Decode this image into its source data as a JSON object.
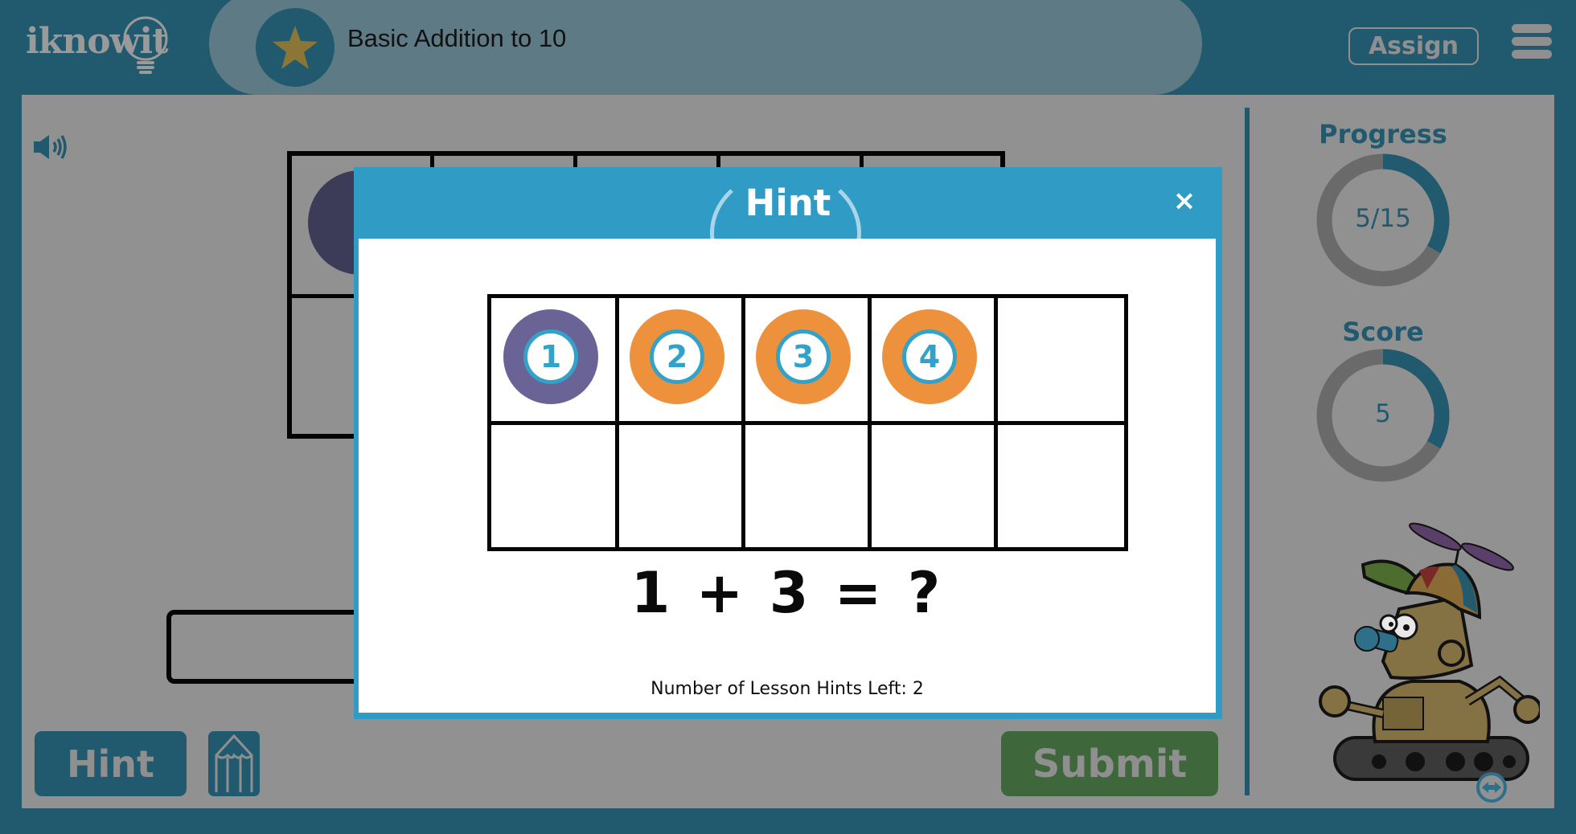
{
  "app": {
    "logo_text": "iknowit",
    "lesson_title": "Basic Addition to 10",
    "assign_label": "Assign",
    "menu_icon": "hamburger-menu-icon",
    "lesson_icon": "star-icon"
  },
  "colors": {
    "brand_dark": "#215a6e",
    "modal_blue": "#309bc5",
    "counter_purple": "#6a6496",
    "counter_orange": "#ee913d",
    "submit_green": "#4e8a4a"
  },
  "workspace": {
    "sound_icon": "speaker-icon",
    "hint_button_label": "Hint",
    "pencil_icon": "pencil-icon",
    "submit_button_label": "Submit",
    "answer_value": ""
  },
  "sidebar": {
    "progress": {
      "label": "Progress",
      "text": "5/15",
      "current": 5,
      "total": 15,
      "fraction": 0.3333
    },
    "score": {
      "label": "Score",
      "text": "5",
      "fraction": 0.3333
    },
    "mascot": "robot-mascot",
    "resize_icon": "swap-horizontal-icon"
  },
  "modal": {
    "title": "Hint",
    "close_label": "×",
    "ten_frame": {
      "rows": 2,
      "cols": 5,
      "counters": [
        {
          "number": "1",
          "color": "purple"
        },
        {
          "number": "2",
          "color": "orange"
        },
        {
          "number": "3",
          "color": "orange"
        },
        {
          "number": "4",
          "color": "orange"
        }
      ]
    },
    "equation": "1 + 3 = ?",
    "hints_left_text": "Number of Lesson Hints Left: 2"
  }
}
